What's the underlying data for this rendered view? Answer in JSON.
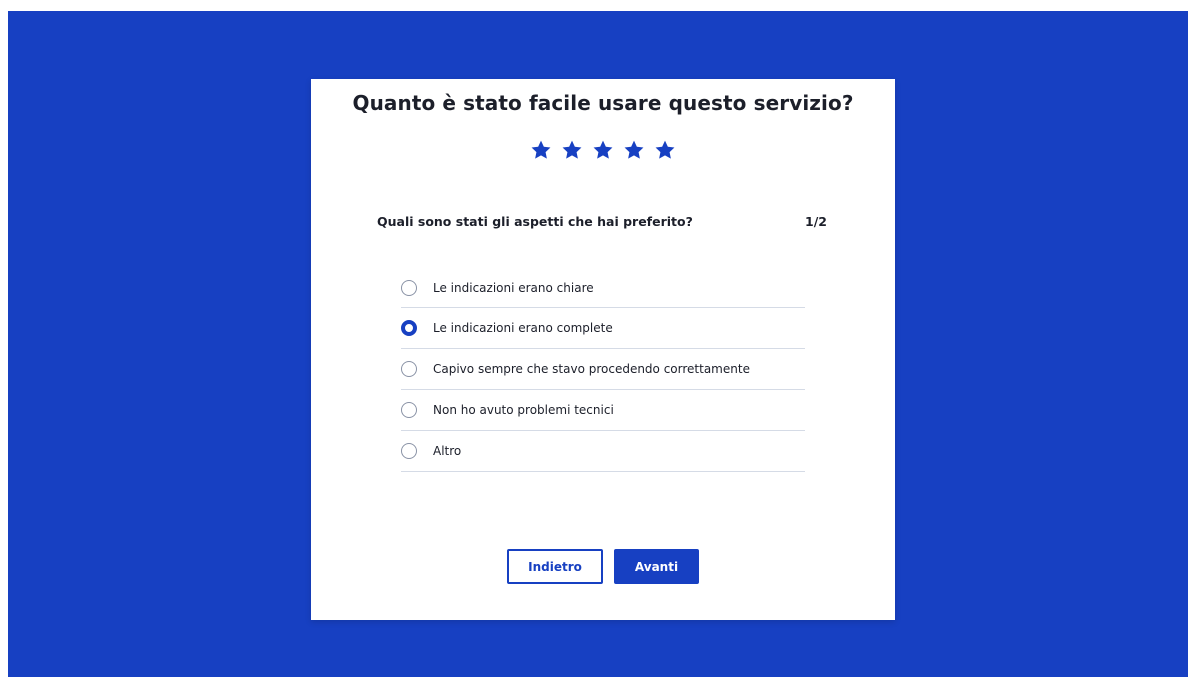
{
  "colors": {
    "backdrop": "#1740c2",
    "accent": "#1740c2",
    "panel": "#ffffff",
    "text": "#1c1f2a"
  },
  "modal": {
    "title": "Quanto è stato facile usare questo servizio?",
    "rating": {
      "value": 5,
      "max": 5,
      "icon": "star-icon"
    },
    "question": "Quali sono stati gli aspetti che hai preferito?",
    "step": "1/2",
    "options": [
      {
        "label": "Le indicazioni erano chiare",
        "selected": false
      },
      {
        "label": "Le indicazioni erano complete",
        "selected": true
      },
      {
        "label": "Capivo sempre che stavo procedendo correttamente",
        "selected": false
      },
      {
        "label": "Non ho avuto problemi tecnici",
        "selected": false
      },
      {
        "label": "Altro",
        "selected": false
      }
    ],
    "buttons": {
      "back_label": "Indietro",
      "next_label": "Avanti"
    }
  }
}
